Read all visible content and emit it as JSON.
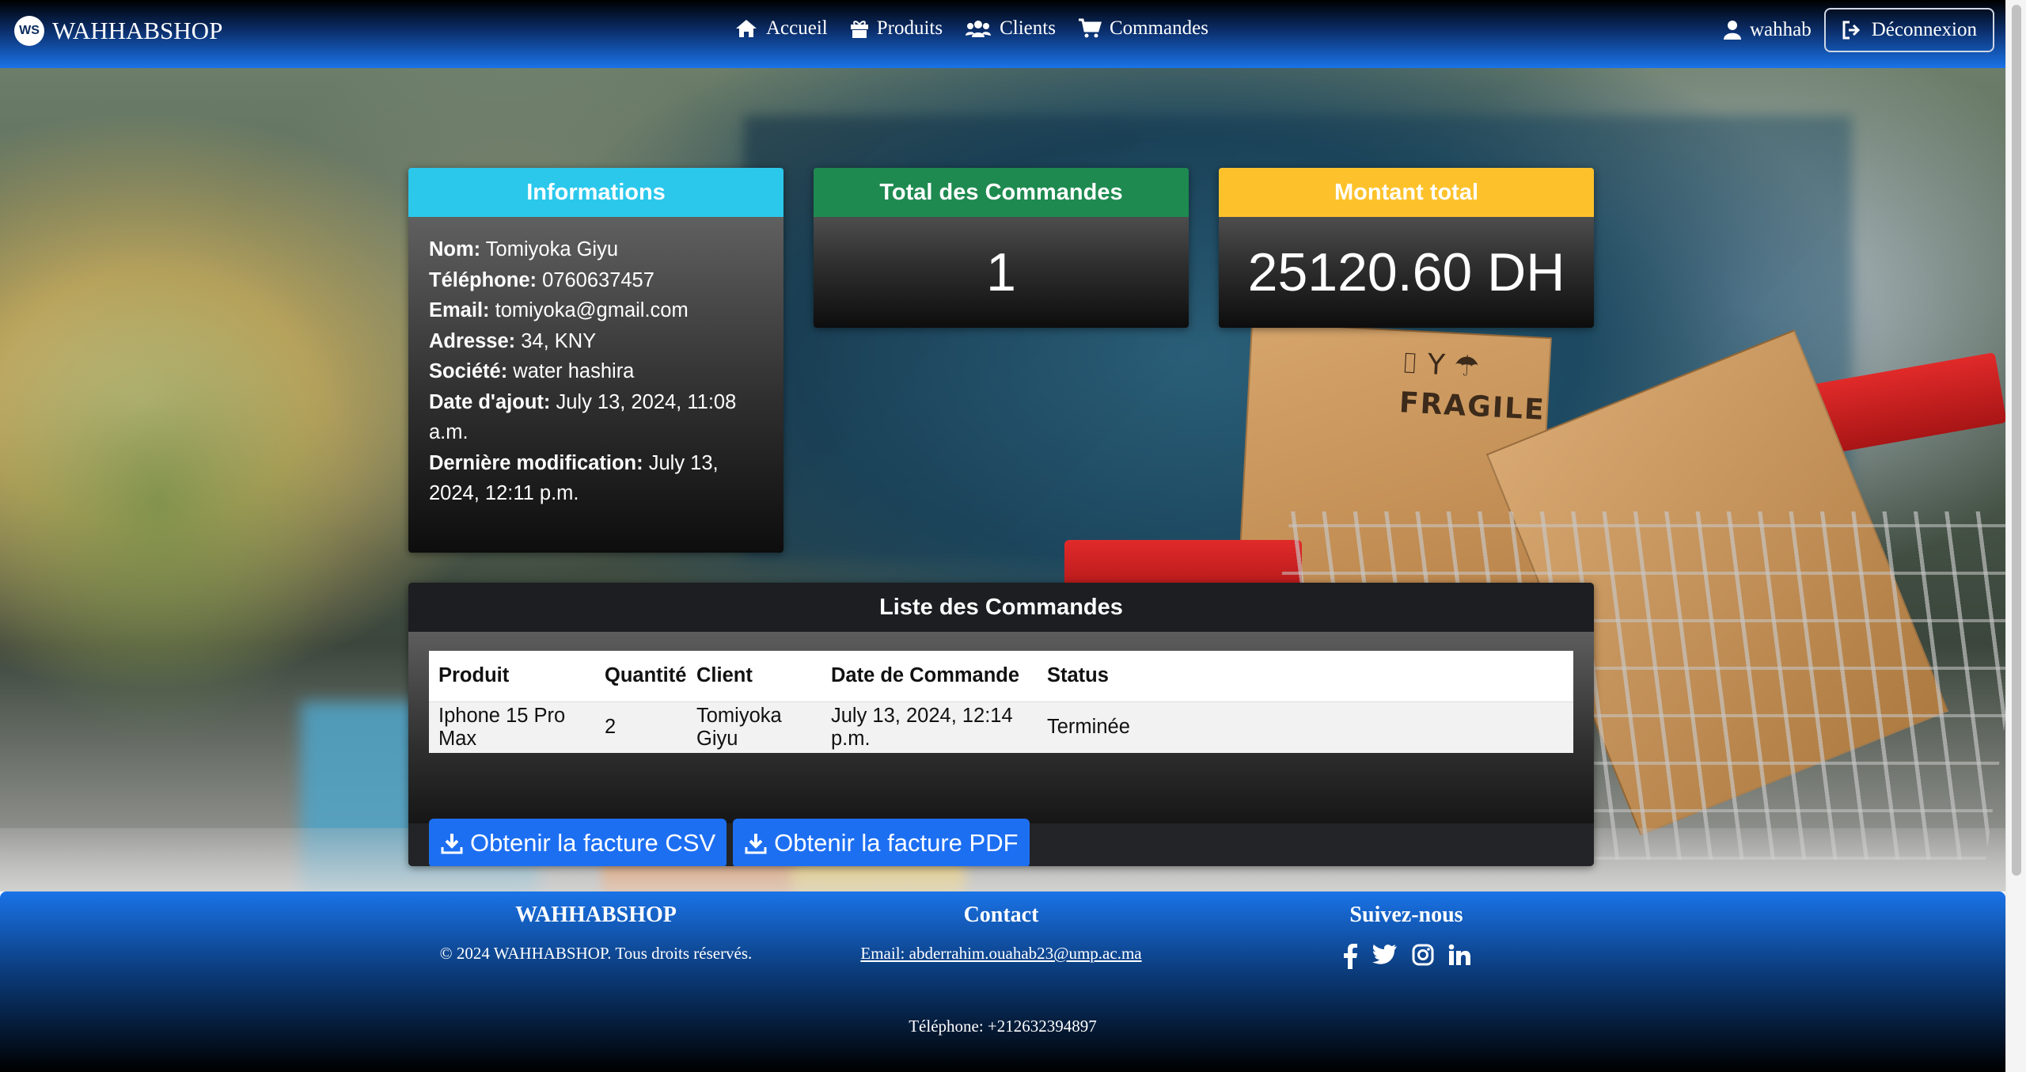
{
  "brand": {
    "name": "WAHHABSHOP",
    "logo_text": "WS"
  },
  "nav": {
    "links": [
      {
        "label": "Accueil",
        "icon": "home-icon"
      },
      {
        "label": "Produits",
        "icon": "gift-icon"
      },
      {
        "label": "Clients",
        "icon": "users-icon"
      },
      {
        "label": "Commandes",
        "icon": "cart-icon"
      }
    ],
    "user": "wahhab",
    "logout": "Déconnexion"
  },
  "info": {
    "title": "Informations",
    "fields": [
      {
        "label": "Nom:",
        "value": " Tomiyoka Giyu"
      },
      {
        "label": "Téléphone:",
        "value": " 0760637457"
      },
      {
        "label": "Email:",
        "value": " tomiyoka@gmail.com"
      },
      {
        "label": "Adresse:",
        "value": " 34, KNY"
      },
      {
        "label": "Société:",
        "value": " water hashira"
      },
      {
        "label": "Date d'ajout:",
        "value": " July 13, 2024, 11:08 a.m."
      },
      {
        "label": "Dernière modification:",
        "value": " July 13, 2024, 12:11 p.m."
      }
    ]
  },
  "total": {
    "title": "Total des Commandes",
    "value": "1"
  },
  "montant": {
    "title": "Montant total",
    "value": "25120.60 DH"
  },
  "orders": {
    "title": "Liste des Commandes",
    "columns": [
      "Produit",
      "Quantité",
      "Client",
      "Date de Commande",
      "Status"
    ],
    "rows": [
      [
        "Iphone 15 Pro Max",
        "2",
        "Tomiyoka Giyu",
        "July 13, 2024, 12:14 p.m.",
        "Terminée"
      ]
    ],
    "btn_csv": "Obtenir la facture CSV",
    "btn_pdf": "Obtenir la facture PDF"
  },
  "footer": {
    "brand_title": "WAHHABSHOP",
    "copyright": "© 2024 WAHHABSHOP. Tous droits réservés.",
    "contact_title": "Contact",
    "email": "Email: abderrahim.ouahab23@ump.ac.ma",
    "follow_title": "Suivez-nous",
    "socials": [
      "facebook-icon",
      "twitter-icon",
      "instagram-icon",
      "linkedin-icon"
    ],
    "phone": "Téléphone: +212632394897"
  },
  "background_image": {
    "fragile_label": "FRAGILE"
  },
  "colors": {
    "info_header": "#2bc8ec",
    "total_header": "#1e8a50",
    "montant_header": "#fdc22b",
    "button": "#1d6ff2"
  }
}
